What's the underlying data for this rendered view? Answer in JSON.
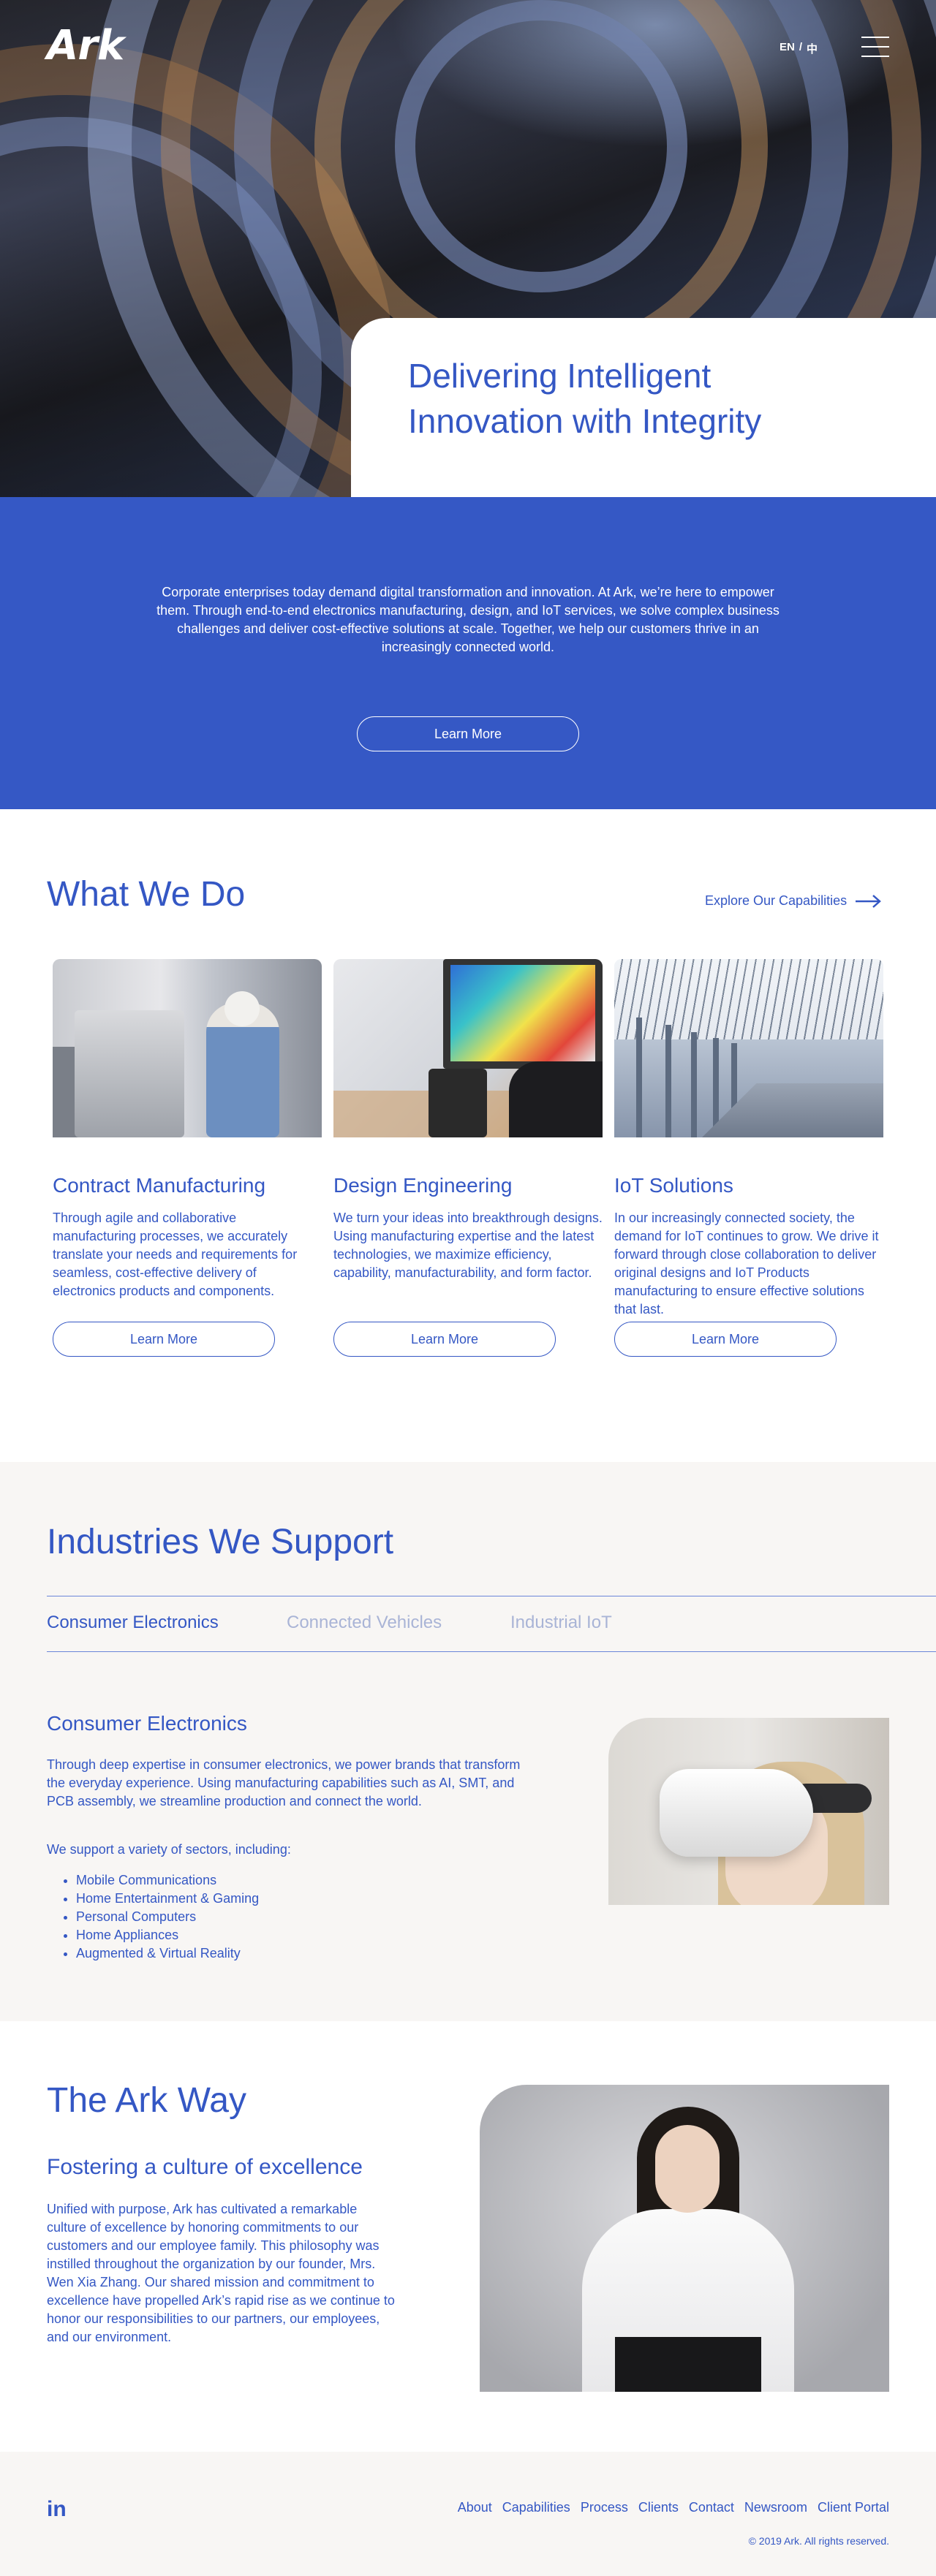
{
  "header": {
    "logo": "Ark",
    "lang_en": "EN",
    "lang_sep": "/",
    "lang_zh": "中"
  },
  "hero": {
    "headline": "Delivering Intelligent Innovation with Integrity"
  },
  "intro": {
    "text": "Corporate enterprises today demand digital transformation and innovation. At Ark, we’re here to empower them. Through end-to-end electronics manufacturing, design, and IoT services, we solve complex business challenges and deliver cost-effective solutions at scale. Together, we help our customers thrive in an increasingly connected world.",
    "button": "Learn More"
  },
  "what_we_do": {
    "title": "What We Do",
    "explore_link": "Explore Our Capabilities",
    "cards": [
      {
        "title": "Contract Manufacturing",
        "text": "Through agile and collaborative manufacturing processes, we accurately translate your needs and requirements for seamless, cost-effective delivery of electronics products and components.",
        "button": "Learn More"
      },
      {
        "title": "Design Engineering",
        "text": "We turn your ideas into breakthrough designs. Using manufacturing expertise and the latest technologies, we maximize efficiency, capability, manufacturability, and form factor.",
        "button": "Learn More"
      },
      {
        "title": "IoT Solutions",
        "text": "In our increasingly connected society, the demand for IoT continues to grow. We drive it forward through close collaboration to deliver original designs and IoT Products manufacturing to ensure effective solutions that last.",
        "button": "Learn More"
      }
    ]
  },
  "industries": {
    "title": "Industries We Support",
    "tabs": [
      "Consumer Electronics",
      "Connected Vehicles",
      "Industrial IoT"
    ],
    "subtitle": "Consumer Electronics",
    "body": "Through deep expertise in consumer electronics, we power brands that transform the everyday experience. Using manufacturing capabilities such as AI, SMT, and PCB assembly, we streamline production and connect the world.",
    "support_intro": "We support a variety of sectors, including:",
    "sectors": [
      "Mobile Communications",
      "Home Entertainment & Gaming",
      "Personal Computers",
      "Home Appliances",
      "Augmented & Virtual Reality"
    ]
  },
  "ark_way": {
    "title": "The Ark Way",
    "subtitle": "Fostering a culture of excellence",
    "body": "Unified with purpose, Ark has cultivated a remarkable culture of excellence by honoring commitments to our customers and our employee family. This philosophy was instilled throughout the organization by our founder, Mrs. Wen Xia Zhang. Our shared mission and commitment to excellence have propelled Ark’s rapid rise as we continue to honor our responsibilities to our partners, our employees, and our environment."
  },
  "footer": {
    "social": "in",
    "nav": [
      "About",
      "Capabilities",
      "Process",
      "Clients",
      "Contact",
      "Newsroom",
      "Client Portal"
    ],
    "copyright": "© 2019 Ark. All rights reserved."
  },
  "colors": {
    "brand_blue": "#3457c4",
    "light_bg": "#f8f6f4",
    "inactive_tab": "#a9b4d6"
  }
}
